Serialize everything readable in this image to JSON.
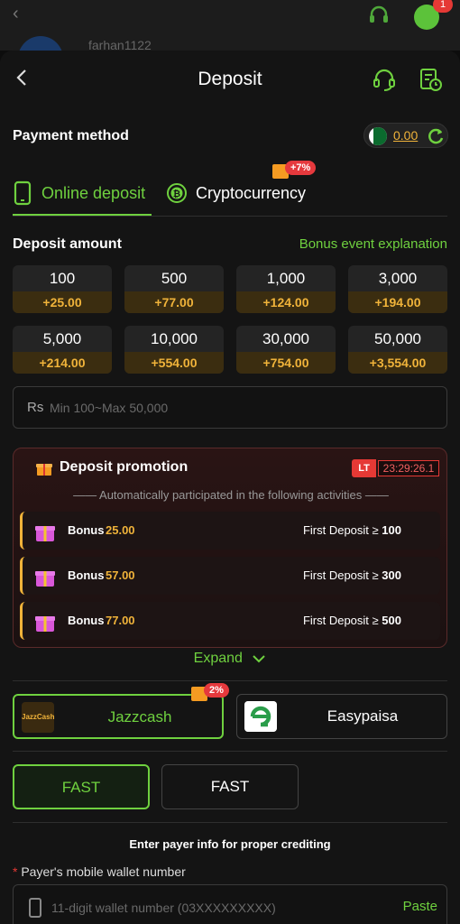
{
  "background": {
    "username": "farhan1122",
    "chat_badge": "1"
  },
  "header": {
    "title": "Deposit"
  },
  "payment": {
    "label": "Payment method",
    "balance": "0.00"
  },
  "tabs": [
    {
      "label": "Online deposit",
      "active": true
    },
    {
      "label": "Cryptocurrency",
      "badge": "+7%"
    }
  ],
  "deposit_amount": {
    "label": "Deposit amount",
    "bonus_link": "Bonus event explanation",
    "options": [
      {
        "amount": "100",
        "bonus": "+25.00"
      },
      {
        "amount": "500",
        "bonus": "+77.00"
      },
      {
        "amount": "1,000",
        "bonus": "+124.00"
      },
      {
        "amount": "3,000",
        "bonus": "+194.00"
      },
      {
        "amount": "5,000",
        "bonus": "+214.00"
      },
      {
        "amount": "10,000",
        "bonus": "+554.00"
      },
      {
        "amount": "30,000",
        "bonus": "+754.00"
      },
      {
        "amount": "50,000",
        "bonus": "+3,554.00"
      }
    ],
    "currency": "Rs",
    "placeholder": "Min 100~Max 50,000"
  },
  "promotion": {
    "title": "Deposit promotion",
    "tag": "LT",
    "timer": "23:29:26.1",
    "subtitle": "Automatically participated in the following activities",
    "rows": [
      {
        "label": "Bonus",
        "amount": "25.00",
        "condition": "First Deposit ≥",
        "min": "100"
      },
      {
        "label": "Bonus",
        "amount": "57.00",
        "condition": "First Deposit ≥",
        "min": "300"
      },
      {
        "label": "Bonus",
        "amount": "77.00",
        "condition": "First Deposit ≥",
        "min": "500"
      }
    ],
    "expand": "Expand"
  },
  "methods": [
    {
      "label": "Jazzcash",
      "badge": "2%",
      "logo_text": "JazzCash",
      "selected": true
    },
    {
      "label": "Easypaisa",
      "selected": false
    }
  ],
  "channels": [
    {
      "label": "FAST",
      "selected": true
    },
    {
      "label": "FAST",
      "selected": false
    }
  ],
  "payer": {
    "info": "Enter payer info for proper crediting",
    "required_mark": "*",
    "mobile_label": "Payer's mobile wallet number",
    "mobile_placeholder": "11-digit wallet number (03XXXXXXXXX)",
    "paste": "Paste"
  },
  "colors": {
    "accent": "#6fd13f",
    "gold": "#f0b33a",
    "red": "#e53935",
    "bg": "#141414"
  }
}
